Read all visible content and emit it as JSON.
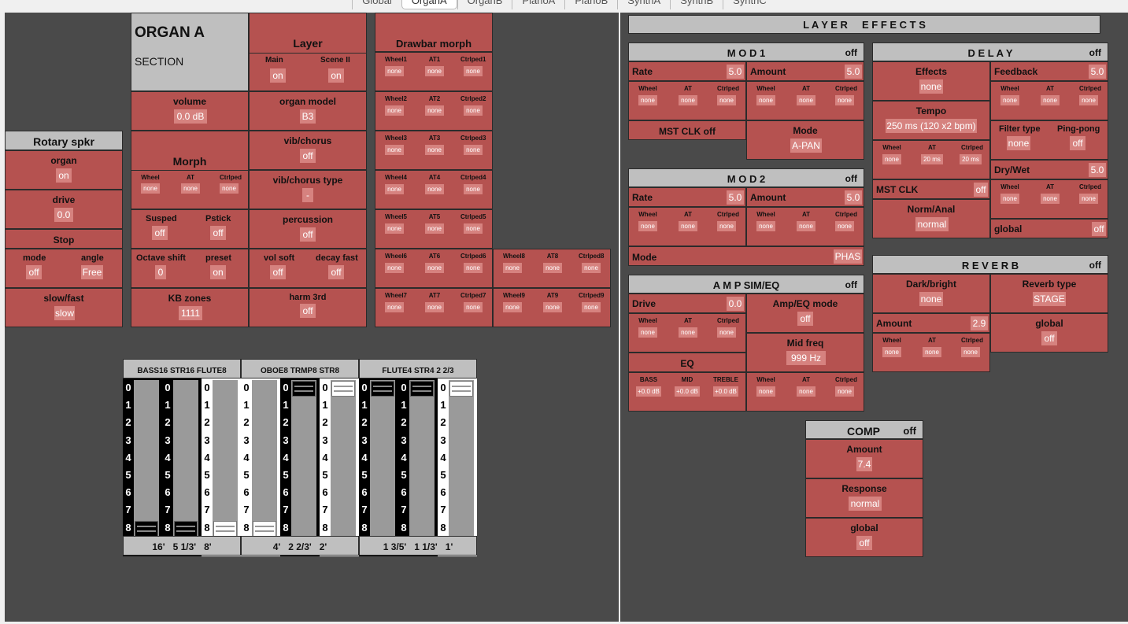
{
  "tabs": {
    "items": [
      "Global",
      "OrganA",
      "OrganB",
      "PianoA",
      "PianoB",
      "SynthA",
      "SynthB",
      "SynthC"
    ],
    "active": "OrganA"
  },
  "header": {
    "title": "ORGAN A",
    "subtitle": "SECTION"
  },
  "layer": {
    "title": "Layer",
    "main_label": "Main",
    "main_value": "on",
    "scene_label": "Scene II",
    "scene_value": "on"
  },
  "volume": {
    "label": "volume",
    "value": "0.0 dB"
  },
  "organ_model": {
    "label": "organ model",
    "value": "B3"
  },
  "morph": {
    "title": "Morph",
    "wheel": "Wheel",
    "at": "AT",
    "ctrlped": "Ctrlped",
    "wheel_v": "none",
    "at_v": "none",
    "ctrlped_v": "none"
  },
  "vib_chorus": {
    "label": "vib/chorus",
    "value": "off"
  },
  "vib_chorus_type": {
    "label": "vib/chorus type",
    "value": "-"
  },
  "susped": {
    "label": "Susped",
    "value": "off"
  },
  "pstick": {
    "label": "Pstick",
    "value": "off"
  },
  "percussion": {
    "label": "percussion",
    "value": "off"
  },
  "octave_shift": {
    "label": "Octave shift",
    "value": "0"
  },
  "preset": {
    "label": "preset",
    "value": "on"
  },
  "vol_soft": {
    "label": "vol soft",
    "value": "off"
  },
  "decay_fast": {
    "label": "decay fast",
    "value": "off"
  },
  "kb_zones": {
    "label": "KB zones",
    "value": "1111"
  },
  "harm_3rd": {
    "label": "harm 3rd",
    "value": "off"
  },
  "drawbar_morph": {
    "title": "Drawbar morph",
    "rows": [
      {
        "w": "Wheel1",
        "a": "AT1",
        "c": "Ctrlped1",
        "wv": "none",
        "av": "none",
        "cv": "none"
      },
      {
        "w": "Wheel2",
        "a": "AT2",
        "c": "Ctrlped2",
        "wv": "none",
        "av": "none",
        "cv": "none"
      },
      {
        "w": "Wheel3",
        "a": "AT3",
        "c": "Ctrlped3",
        "wv": "none",
        "av": "none",
        "cv": "none"
      },
      {
        "w": "Wheel4",
        "a": "AT4",
        "c": "Ctrlped4",
        "wv": "none",
        "av": "none",
        "cv": "none"
      },
      {
        "w": "Wheel5",
        "a": "AT5",
        "c": "Ctrlped5",
        "wv": "none",
        "av": "none",
        "cv": "none"
      },
      {
        "w": "Wheel6",
        "a": "AT6",
        "c": "Ctrlped6",
        "wv": "none",
        "av": "none",
        "cv": "none"
      },
      {
        "w": "Wheel7",
        "a": "AT7",
        "c": "Ctrlped7",
        "wv": "none",
        "av": "none",
        "cv": "none"
      },
      {
        "w": "Wheel8",
        "a": "AT8",
        "c": "Ctrlped8",
        "wv": "none",
        "av": "none",
        "cv": "none"
      },
      {
        "w": "Wheel9",
        "a": "AT9",
        "c": "Ctrlped9",
        "wv": "none",
        "av": "none",
        "cv": "none"
      }
    ]
  },
  "rotary": {
    "title": "Rotary spkr",
    "organ_label": "organ",
    "organ_value": "on",
    "drive_label": "drive",
    "drive_value": "0.0",
    "stop_label": "Stop",
    "mode_label": "mode",
    "mode_value": "off",
    "angle_label": "angle",
    "angle_value": "Free",
    "slowfast_label": "slow/fast",
    "slowfast_value": "slow"
  },
  "drawbars": {
    "groups": [
      {
        "header": "BASS16 STR16 FLUTE8",
        "footer": "16'   5 1/3'   8'"
      },
      {
        "header": "OBOE8 TRMP8  STR8",
        "footer": "4'   2 2/3'   2'"
      },
      {
        "header": "FLUTE4   STR4   2 2/3",
        "footer": "1 3/5'   1 1/3'   1'"
      }
    ],
    "numbers": [
      "0",
      "1",
      "2",
      "3",
      "4",
      "5",
      "6",
      "7",
      "8"
    ],
    "bars": [
      {
        "level": 8,
        "style": "black"
      },
      {
        "level": 8,
        "style": "black"
      },
      {
        "level": 8,
        "style": "white"
      },
      {
        "level": 8,
        "style": "white"
      },
      {
        "level": 0,
        "style": "black"
      },
      {
        "level": 0,
        "style": "white"
      },
      {
        "level": 0,
        "style": "black"
      },
      {
        "level": 0,
        "style": "black"
      },
      {
        "level": 0,
        "style": "white"
      }
    ]
  },
  "layer_effects": {
    "title": "L A Y E R     E F F E C T S"
  },
  "mod1": {
    "title": "M O D 1",
    "state": "off",
    "rate_label": "Rate",
    "rate_value": "5.0",
    "amount_label": "Amount",
    "amount_value": "5.0",
    "mst_clk": "MST CLK off",
    "mode_label": "Mode",
    "mode_value": "A-PAN"
  },
  "mod2": {
    "title": "M O D 2",
    "state": "off",
    "rate_label": "Rate",
    "rate_value": "5.0",
    "amount_label": "Amount",
    "amount_value": "5.0",
    "mode_label": "Mode",
    "mode_value": "PHAS"
  },
  "amp": {
    "title": "A M P  SIM/EQ",
    "state": "off",
    "drive_label": "Drive",
    "drive_value": "0.0",
    "mode_label": "Amp/EQ mode",
    "mode_value": "off",
    "eq_label": "EQ",
    "bass_label": "BASS",
    "mid_label": "MID",
    "treble_label": "TREBLE",
    "bass_value": "+0.0 dB",
    "mid_value": "+0.0 dB",
    "treble_value": "+0.0 dB",
    "midfreq_label": "Mid freq",
    "midfreq_value": "999 Hz"
  },
  "delay": {
    "title": "D E L A Y",
    "state": "off",
    "effects_label": "Effects",
    "effects_value": "none",
    "feedback_label": "Feedback",
    "feedback_value": "5.0",
    "tempo_label": "Tempo",
    "tempo_value": "250 ms (120 x2 bpm)",
    "tempo_at": "20 ms",
    "tempo_cp": "20 ms",
    "filter_label": "Filter type",
    "filter_value": "none",
    "ping_label": "Ping-pong",
    "ping_value": "off",
    "drywet_label": "Dry/Wet",
    "drywet_value": "5.0",
    "mstclk_label": "MST CLK",
    "mstclk_value": "off",
    "norm_label": "Norm/Anal",
    "norm_value": "normal",
    "global_label": "global",
    "global_value": "off"
  },
  "reverb": {
    "title": "R E V E R B",
    "state": "off",
    "dark_label": "Dark/bright",
    "dark_value": "none",
    "type_label": "Reverb type",
    "type_value": "STAGE",
    "amount_label": "Amount",
    "amount_value": "2.9",
    "global_label": "global",
    "global_value": "off"
  },
  "comp": {
    "title": "COMP",
    "state": "off",
    "amount_label": "Amount",
    "amount_value": "7.4",
    "response_label": "Response",
    "response_value": "normal",
    "global_label": "global",
    "global_value": "off"
  },
  "mod_labels": {
    "wheel": "Wheel",
    "at": "AT",
    "ctrlped": "Ctrlped",
    "none": "none"
  }
}
